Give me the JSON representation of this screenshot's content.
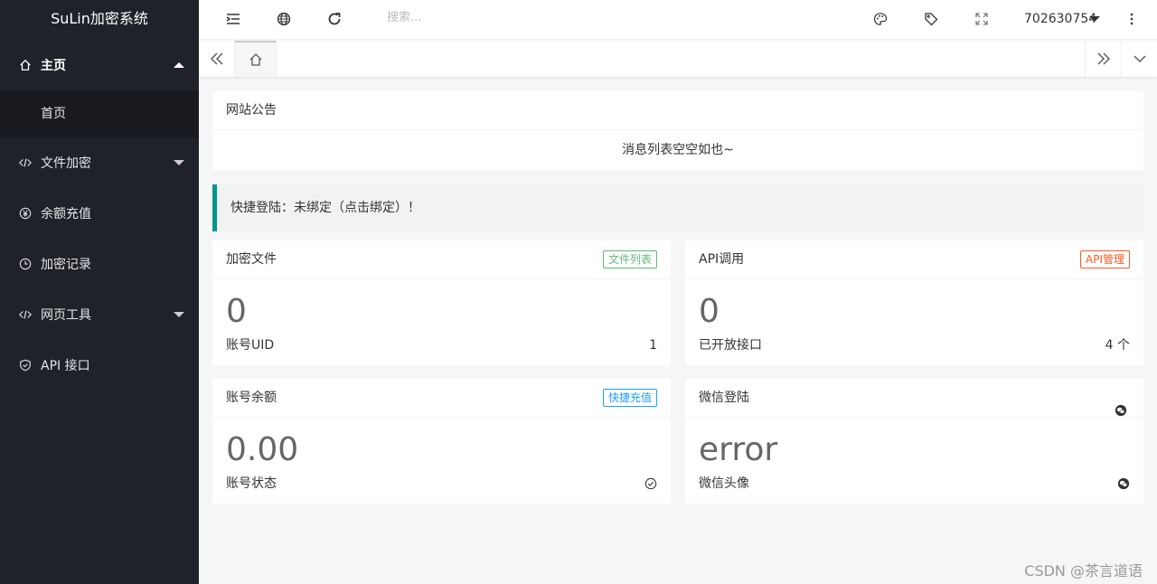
{
  "app": {
    "title": "SuLin加密系统"
  },
  "sidebar": {
    "items": [
      {
        "label": "主页",
        "icon": "home-icon",
        "expanded": true
      },
      {
        "label": "首页",
        "icon": "",
        "sub": true
      },
      {
        "label": "文件加密",
        "icon": "code-icon",
        "expanded": false
      },
      {
        "label": "余额充值",
        "icon": "yen-icon"
      },
      {
        "label": "加密记录",
        "icon": "clock-icon"
      },
      {
        "label": "网页工具",
        "icon": "code-icon",
        "expanded": false
      },
      {
        "label": "API 接口",
        "icon": "shield-icon"
      }
    ]
  },
  "header": {
    "search_placeholder": "搜索...",
    "username": "702630754"
  },
  "notice": {
    "title": "网站公告",
    "empty_text": "消息列表空空如也~"
  },
  "quick_login": {
    "text": "快捷登陆：未绑定（点击绑定）！"
  },
  "cards": {
    "files": {
      "title": "加密文件",
      "badge": "文件列表",
      "value": "0",
      "label": "账号UID",
      "label_value": "1"
    },
    "api": {
      "title": "API调用",
      "badge": "API管理",
      "value": "0",
      "label": "已开放接口",
      "label_value": "4 个"
    },
    "balance": {
      "title": "账号余额",
      "badge": "快捷充值",
      "value": "0.00",
      "label": "账号状态"
    },
    "wechat": {
      "title": "微信登陆",
      "value": "error",
      "label": "微信头像"
    }
  },
  "watermark": "CSDN @茶言道语",
  "colors": {
    "sidebar_bg": "#20222a",
    "accent": "#009688",
    "green": "#5fb878",
    "red": "#ff5722",
    "blue": "#1e9fff"
  }
}
